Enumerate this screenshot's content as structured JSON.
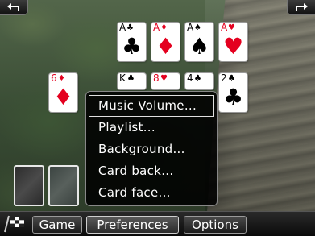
{
  "toolbar": {
    "back_icon": "undo-arrow-icon",
    "forward_icon": "redo-arrow-icon"
  },
  "foundations": [
    {
      "rank": "A",
      "suit": "♣",
      "color": "black"
    },
    {
      "rank": "A",
      "suit": "♦",
      "color": "red"
    },
    {
      "rank": "A",
      "suit": "♠",
      "color": "black"
    },
    {
      "rank": "A",
      "suit": "♥",
      "color": "red"
    }
  ],
  "tableau": [
    {
      "rank": "6",
      "suit": "♦",
      "color": "red"
    },
    {
      "rank": "K",
      "suit": "♣",
      "color": "black"
    },
    {
      "rank": "8",
      "suit": "♥",
      "color": "red"
    },
    {
      "rank": "4",
      "suit": "♣",
      "color": "black"
    },
    {
      "rank": "2",
      "suit": "♣",
      "color": "black"
    }
  ],
  "menu": {
    "items": [
      "Music Volume...",
      "Playlist...",
      "Background...",
      "Card back...",
      "Card face..."
    ],
    "selected_index": 0
  },
  "bottom": {
    "logo_icon": "checkered-flag-icon",
    "tabs": [
      "Game",
      "Preferences",
      "Options"
    ],
    "active_tab": "Preferences"
  }
}
